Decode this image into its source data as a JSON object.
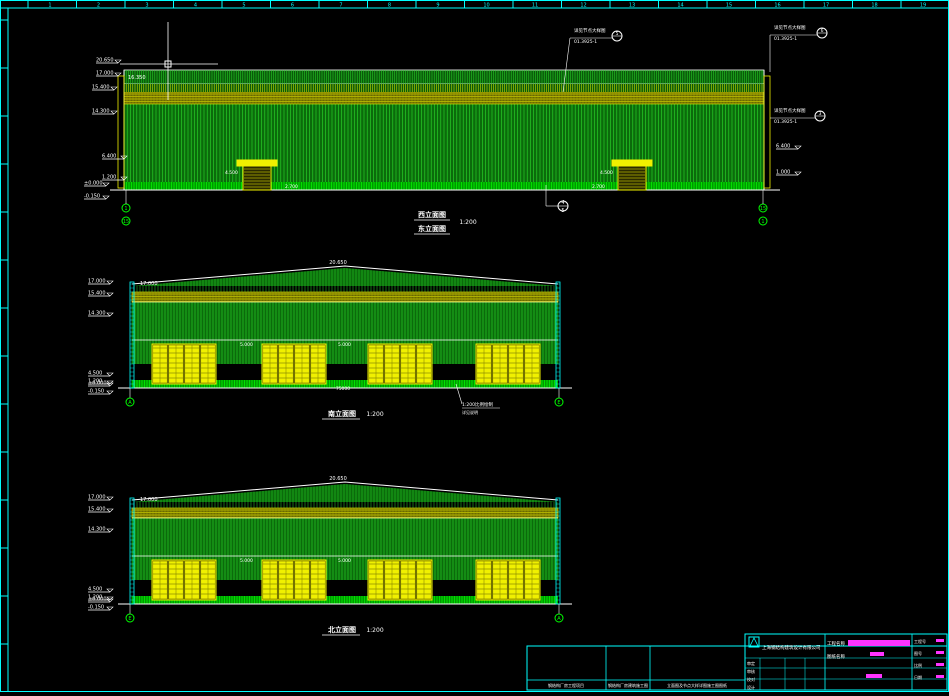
{
  "colors": {
    "background": "#000000",
    "frame": "#00ffff",
    "wall": "#0b6b0b",
    "wall_line": "#2bdc2b",
    "yellow": "#f0f000",
    "green": "#00ff00",
    "white": "#ffffff",
    "magenta": "#ff33ff"
  },
  "grid_ruler_numbers": [
    "1",
    "2",
    "3",
    "4",
    "5",
    "6",
    "7",
    "8",
    "9",
    "10",
    "11",
    "12",
    "13",
    "14",
    "15",
    "16",
    "17",
    "18",
    "19",
    "20"
  ],
  "views": {
    "top": {
      "title_primary": "西立面图",
      "title_secondary": "东立面图",
      "scale": "1:200",
      "elevations": [
        "20.650",
        "17.000",
        "15.400",
        "14.300",
        "6.400",
        "1.200",
        "±0.000",
        "-0.150"
      ],
      "level_right": [
        "6.400",
        "1.000"
      ],
      "top_mark": "16.350",
      "door_marks": [
        "4.500",
        "4.500"
      ],
      "floor_marks": [
        "2.700",
        "2.700"
      ],
      "axis_left": [
        "1",
        "15"
      ],
      "axis_right": [
        "15",
        "1"
      ],
      "axis_mid": [
        "4",
        "5"
      ],
      "callouts": [
        {
          "text": "详见节点大样图",
          "ref": "01.3925-1",
          "num": "5"
        },
        {
          "text": "详见节点大样图",
          "ref": "01.3925-1",
          "num": "6"
        },
        {
          "text": "详见节点大样图",
          "ref": "01.3925-1",
          "num": "3"
        }
      ]
    },
    "middle": {
      "title": "南立面图",
      "scale": "1:200",
      "ridge_mark": "20.650",
      "elevations": [
        "17.000",
        "15.400",
        "14.300",
        "4.500",
        "1.200",
        "±0.000",
        "-0.150"
      ],
      "eave_mark": "17.000",
      "door_marks": [
        "5.000",
        "5.000"
      ],
      "width_dim": "75000",
      "note_line1": "1:200比例绘制",
      "note_line2": "详见说明",
      "axis_left": "A",
      "axis_right": "E"
    },
    "bottom": {
      "title": "北立面图",
      "scale": "1:200",
      "ridge_mark": "20.650",
      "elevations": [
        "17.000",
        "15.400",
        "14.300",
        "4.500",
        "1.200",
        "±0.000",
        "-0.150"
      ],
      "eave_mark": "17.000",
      "door_marks": [
        "5.000",
        "5.000"
      ],
      "axis_left": "E",
      "axis_right": "A"
    }
  },
  "title_block": {
    "company": "上海钢结构建筑设计有限公司",
    "project_label": "工程名称",
    "drawing_label": "图纸名称",
    "row_labels": [
      "审定",
      "审核",
      "校对",
      "设计"
    ],
    "cells": [
      "钢结构厂房工程项目",
      "钢结构厂房建筑施工图",
      "立面图及节点大样详图施工图图纸"
    ],
    "sheet_labels": [
      "工程号",
      "图号",
      "比例",
      "日期"
    ]
  }
}
